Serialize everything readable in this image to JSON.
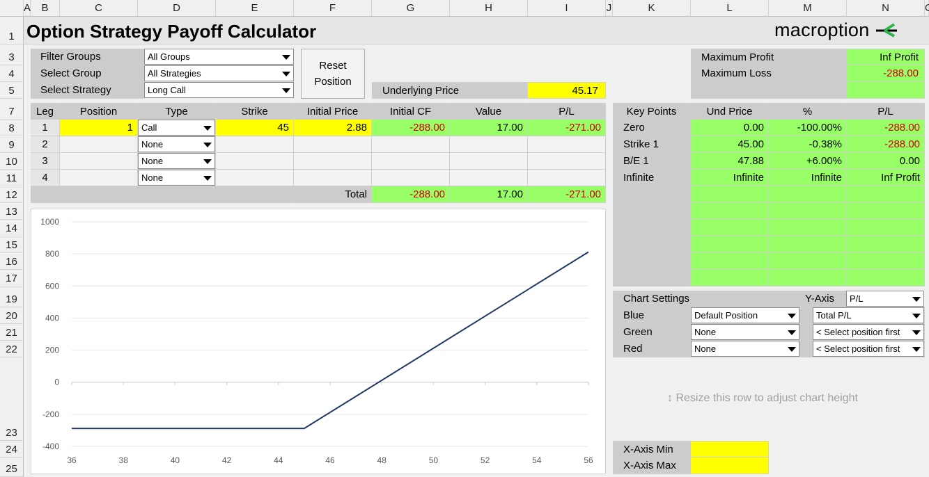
{
  "columns": [
    "A",
    "B",
    "C",
    "D",
    "E",
    "F",
    "G",
    "H",
    "I",
    "J",
    "K",
    "L",
    "M",
    "N",
    "O"
  ],
  "rows": [
    "1",
    "3",
    "4",
    "5",
    "7",
    "8",
    "9",
    "10",
    "11",
    "12",
    "13",
    "14",
    "15",
    "16",
    "17",
    "19",
    "20",
    "21",
    "22",
    "23",
    "24",
    "25"
  ],
  "title": "Option Strategy Payoff Calculator",
  "brand": {
    "name": "macroption",
    "accent": "#2db34a"
  },
  "filters": {
    "filter_groups_label": "Filter Groups",
    "filter_groups_value": "All Groups",
    "select_group_label": "Select Group",
    "select_group_value": "All Strategies",
    "select_strategy_label": "Select Strategy",
    "select_strategy_value": "Long Call"
  },
  "reset_button": {
    "line1": "Reset",
    "line2": "Position"
  },
  "underlying": {
    "label": "Underlying Price",
    "value": "45.17"
  },
  "summary": {
    "max_profit_label": "Maximum Profit",
    "max_profit_value": "Inf Profit",
    "max_loss_label": "Maximum Loss",
    "max_loss_value": "-288.00"
  },
  "legs": {
    "headers": [
      "Leg",
      "Position",
      "Type",
      "Strike",
      "Initial Price",
      "Initial CF",
      "Value",
      "P/L"
    ],
    "rows": [
      {
        "leg": "1",
        "position": "1",
        "type": "Call",
        "strike": "45",
        "price": "2.88",
        "cf": "-288.00",
        "value": "17.00",
        "pl": "-271.00"
      },
      {
        "leg": "2",
        "position": "",
        "type": "None",
        "strike": "",
        "price": "",
        "cf": "",
        "value": "",
        "pl": ""
      },
      {
        "leg": "3",
        "position": "",
        "type": "None",
        "strike": "",
        "price": "",
        "cf": "",
        "value": "",
        "pl": ""
      },
      {
        "leg": "4",
        "position": "",
        "type": "None",
        "strike": "",
        "price": "",
        "cf": "",
        "value": "",
        "pl": ""
      }
    ],
    "total_label": "Total",
    "total_cf": "-288.00",
    "total_value": "17.00",
    "total_pl": "-271.00"
  },
  "key_points": {
    "headers": [
      "Key Points",
      "Und Price",
      "%",
      "P/L"
    ],
    "rows": [
      {
        "name": "Zero",
        "und": "0.00",
        "pct": "-100.00%",
        "pl": "-288.00"
      },
      {
        "name": "Strike 1",
        "und": "45.00",
        "pct": "-0.38%",
        "pl": "-288.00"
      },
      {
        "name": "B/E 1",
        "und": "47.88",
        "pct": "+6.00%",
        "pl": "0.00"
      },
      {
        "name": "Infinite",
        "und": "Infinite",
        "pct": "Infinite",
        "pl": "Inf Profit"
      }
    ]
  },
  "chart_settings": {
    "title": "Chart Settings",
    "yaxis_label": "Y-Axis",
    "yaxis_value": "P/L",
    "rows": [
      {
        "label": "Blue",
        "position": "Default Position",
        "series": "Total P/L"
      },
      {
        "label": "Green",
        "position": "None",
        "series": "< Select position first"
      },
      {
        "label": "Red",
        "position": "None",
        "series": "< Select position first"
      }
    ]
  },
  "resize_hint": "↕ Resize this row to adjust chart height",
  "xaxis": {
    "min_label": "X-Axis Min",
    "min_value": "",
    "max_label": "X-Axis Max",
    "max_value": ""
  },
  "chart_data": {
    "type": "line",
    "xlim": [
      36,
      56
    ],
    "ylim": [
      -400,
      1000
    ],
    "xticks": [
      "36",
      "38",
      "40",
      "42",
      "44",
      "46",
      "48",
      "50",
      "52",
      "54",
      "56"
    ],
    "yticks": [
      "1000",
      "800",
      "600",
      "400",
      "200",
      "0",
      "-200",
      "-400"
    ],
    "series": [
      {
        "color": "#1f3864",
        "x": [
          36,
          45,
          56
        ],
        "y": [
          -288,
          -288,
          812
        ]
      }
    ]
  }
}
